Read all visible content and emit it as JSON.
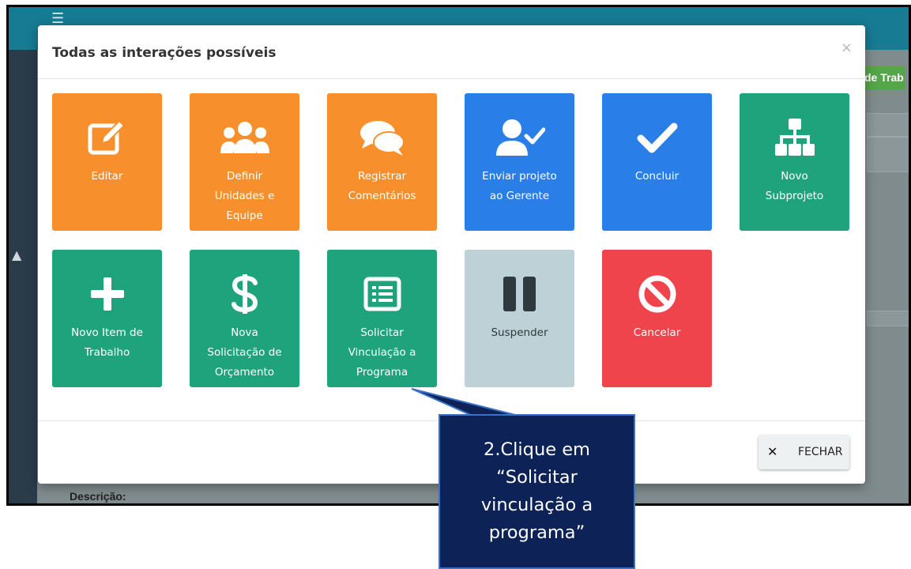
{
  "modal": {
    "title": "Todas as interações possíveis",
    "close_glyph": "×",
    "fechar_label": "FECHAR",
    "fechar_icon": "close-icon"
  },
  "background": {
    "right_tab_text": "de Trab",
    "descricao_label": "Descrição:"
  },
  "tiles": [
    {
      "label": "Editar",
      "color": "#f7902c",
      "icon": "edit-icon"
    },
    {
      "label": "Definir\nUnidades e\nEquipe",
      "color": "#f7902c",
      "icon": "users-icon"
    },
    {
      "label": "Registrar\nComentários",
      "color": "#f7902c",
      "icon": "comments-icon"
    },
    {
      "label": "Enviar projeto\nao Gerente",
      "color": "#2a7ee8",
      "icon": "user-check-icon"
    },
    {
      "label": "Concluir",
      "color": "#2a7ee8",
      "icon": "check-icon"
    },
    {
      "label": "Novo\nSubprojeto",
      "color": "#1ea37d",
      "icon": "sitemap-icon"
    },
    {
      "label": "Novo Item de\nTrabalho",
      "color": "#1ea37d",
      "icon": "plus-icon"
    },
    {
      "label": "Nova\nSolicitação de\nOrçamento",
      "color": "#1ea37d",
      "icon": "dollar-icon"
    },
    {
      "label": "Solicitar\nVinculação a\nPrograma",
      "color": "#1ea37d",
      "icon": "list-alt-icon"
    },
    {
      "label": "Suspender",
      "color": "#bdd1d6",
      "icon": "pause-icon"
    },
    {
      "label": "Cancelar",
      "color": "#f0444c",
      "icon": "ban-icon"
    }
  ],
  "callout": {
    "text": "2.Clique em\n“Solicitar\nvinculação a\nprograma”",
    "background": "#0d2257"
  }
}
